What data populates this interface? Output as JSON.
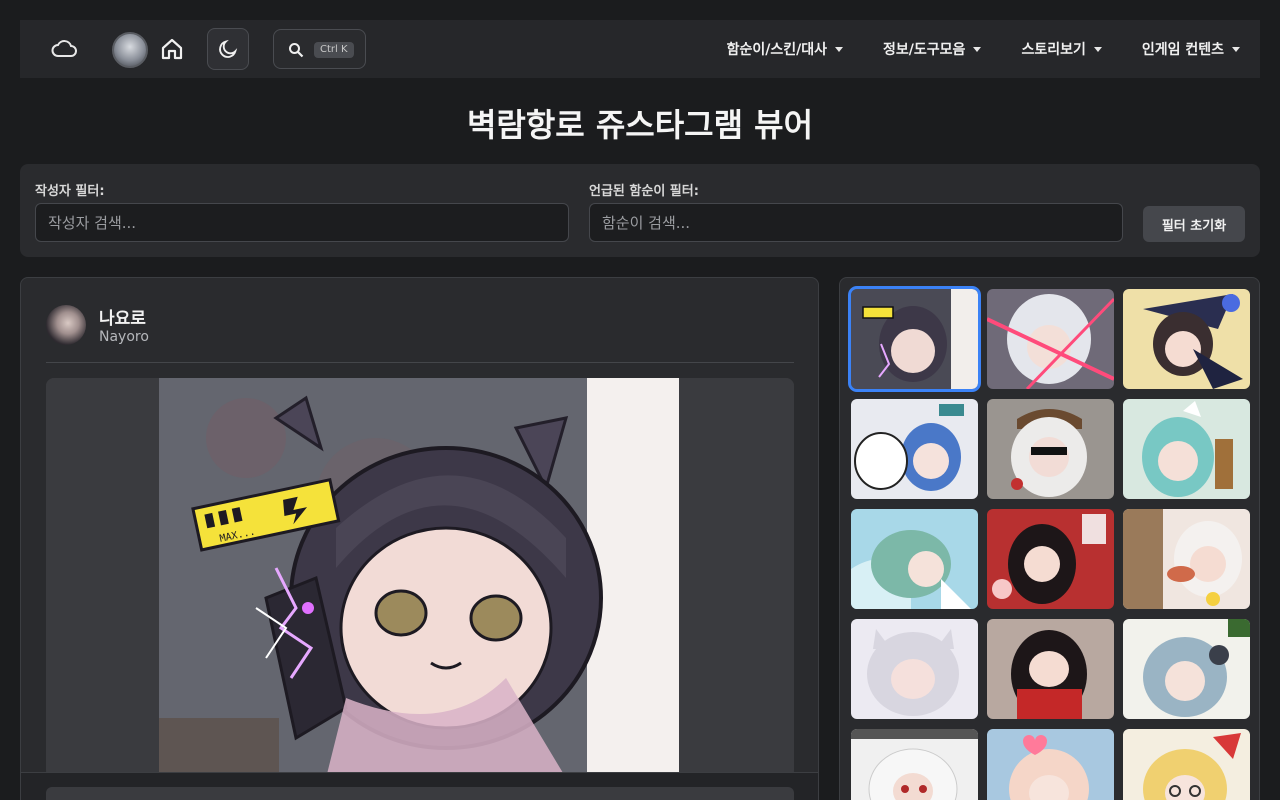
{
  "nav": {
    "search_kbd": "Ctrl K",
    "menu": [
      {
        "label": "함순이/스킨/대사"
      },
      {
        "label": "정보/도구모음"
      },
      {
        "label": "스토리보기"
      },
      {
        "label": "인게임 컨텐츠"
      }
    ],
    "icons": [
      "cloud-icon",
      "home-icon",
      "moon-icon",
      "search-icon",
      "chevron-down-icon"
    ]
  },
  "page": {
    "title": "벽람항로 쥬스타그램 뷰어"
  },
  "filters": {
    "author_label": "작성자 필터:",
    "author_placeholder": "작성자 검색...",
    "ship_label": "언급된 함순이 필터:",
    "ship_placeholder": "함순이 검색...",
    "reset_label": "필터 초기화"
  },
  "post": {
    "author_name": "나요로",
    "author_handle": "Nayoro",
    "image_sticker_text": "MAX..."
  },
  "gallery": {
    "selected_index": 0,
    "thumbnail_count": 15
  },
  "colors": {
    "accent": "#3b82f6",
    "background": "#1b1c1e",
    "panel": "#2a2b2e"
  }
}
